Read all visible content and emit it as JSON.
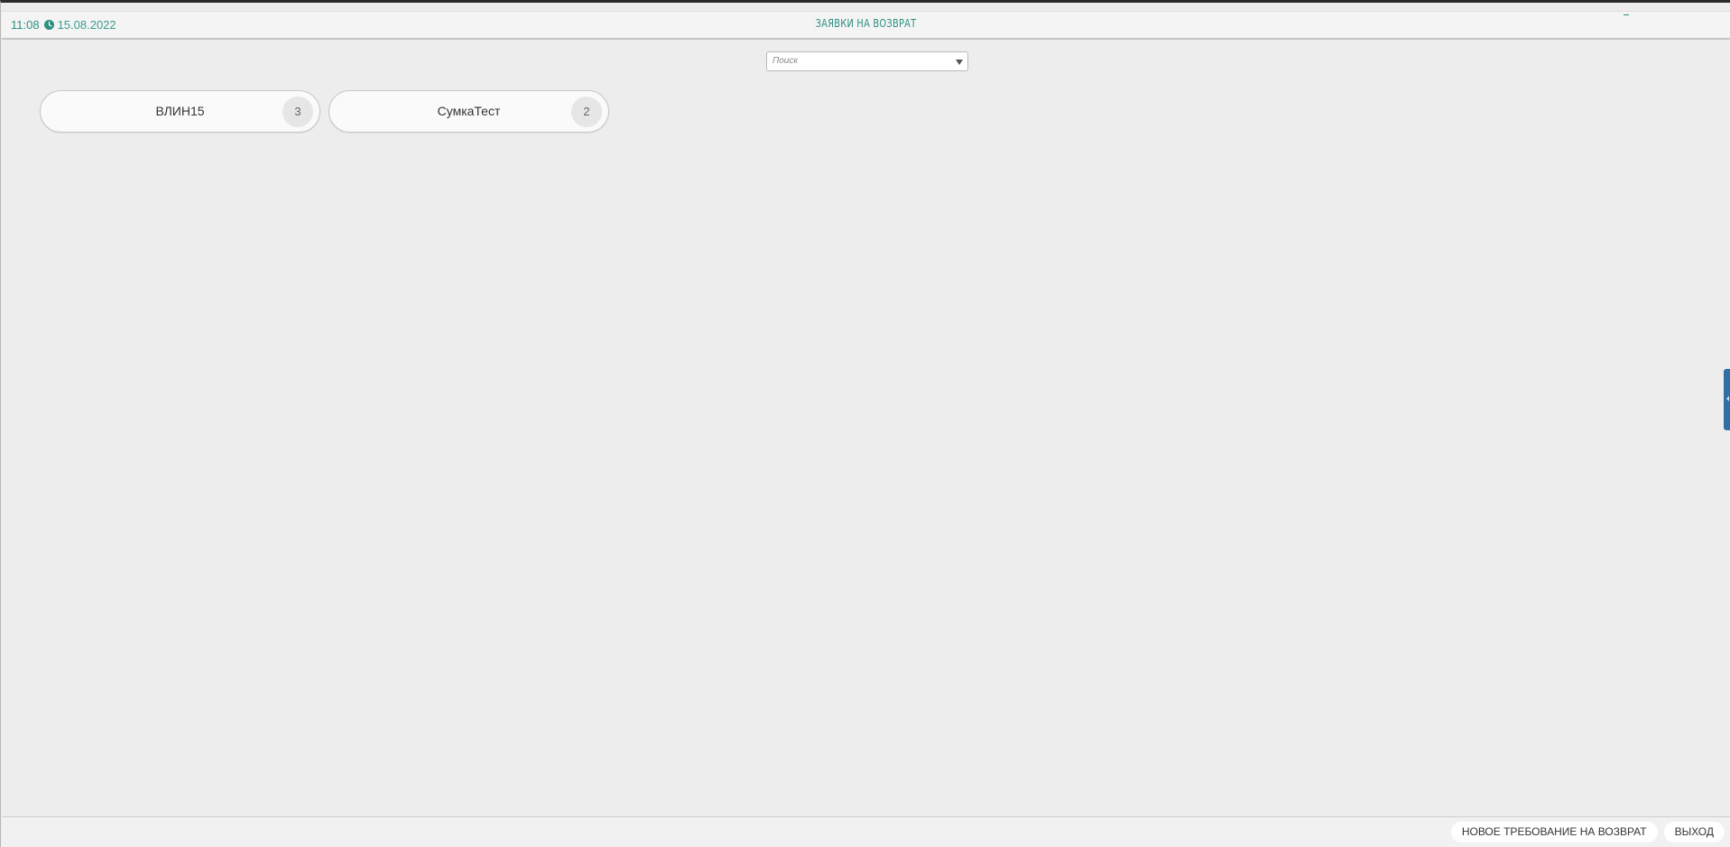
{
  "header": {
    "time": "11:08",
    "date": "15.08.2022",
    "title": "ЗАЯВКИ НА ВОЗВРАТ",
    "clock_icon": "clock-icon"
  },
  "search": {
    "placeholder": "Поиск"
  },
  "cards": [
    {
      "name": "ВЛИН15",
      "count": "3"
    },
    {
      "name": "СумкаТест",
      "count": "2"
    }
  ],
  "footer": {
    "new_request_label": "НОВОЕ ТРЕБОВАНИЕ НА ВОЗВРАТ",
    "exit_label": "ВЫХОД"
  },
  "colors": {
    "accent": "#2b8f80",
    "side_tab": "#2f6fa3",
    "background": "#ededed"
  }
}
